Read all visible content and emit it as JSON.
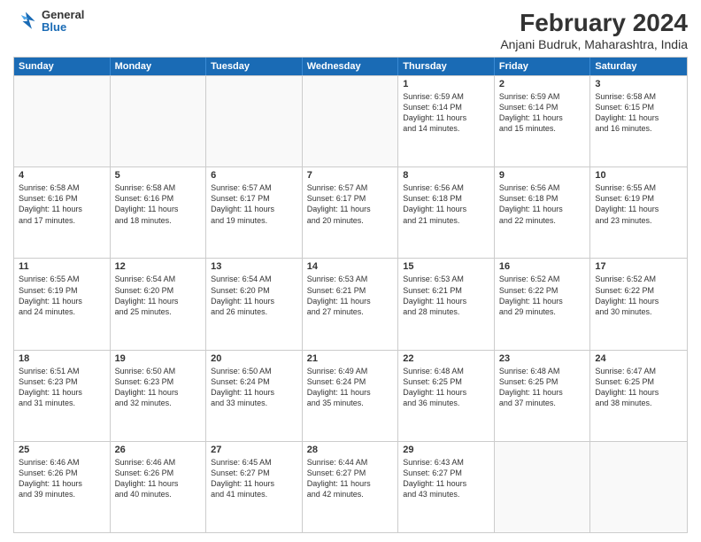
{
  "header": {
    "logo": {
      "general": "General",
      "blue": "Blue"
    },
    "month": "February 2024",
    "location": "Anjani Budruk, Maharashtra, India"
  },
  "weekdays": [
    "Sunday",
    "Monday",
    "Tuesday",
    "Wednesday",
    "Thursday",
    "Friday",
    "Saturday"
  ],
  "rows": [
    [
      {
        "day": "",
        "empty": true
      },
      {
        "day": "",
        "empty": true
      },
      {
        "day": "",
        "empty": true
      },
      {
        "day": "",
        "empty": true
      },
      {
        "day": "1",
        "info": "Sunrise: 6:59 AM\nSunset: 6:14 PM\nDaylight: 11 hours\nand 14 minutes."
      },
      {
        "day": "2",
        "info": "Sunrise: 6:59 AM\nSunset: 6:14 PM\nDaylight: 11 hours\nand 15 minutes."
      },
      {
        "day": "3",
        "info": "Sunrise: 6:58 AM\nSunset: 6:15 PM\nDaylight: 11 hours\nand 16 minutes."
      }
    ],
    [
      {
        "day": "4",
        "info": "Sunrise: 6:58 AM\nSunset: 6:16 PM\nDaylight: 11 hours\nand 17 minutes."
      },
      {
        "day": "5",
        "info": "Sunrise: 6:58 AM\nSunset: 6:16 PM\nDaylight: 11 hours\nand 18 minutes."
      },
      {
        "day": "6",
        "info": "Sunrise: 6:57 AM\nSunset: 6:17 PM\nDaylight: 11 hours\nand 19 minutes."
      },
      {
        "day": "7",
        "info": "Sunrise: 6:57 AM\nSunset: 6:17 PM\nDaylight: 11 hours\nand 20 minutes."
      },
      {
        "day": "8",
        "info": "Sunrise: 6:56 AM\nSunset: 6:18 PM\nDaylight: 11 hours\nand 21 minutes."
      },
      {
        "day": "9",
        "info": "Sunrise: 6:56 AM\nSunset: 6:18 PM\nDaylight: 11 hours\nand 22 minutes."
      },
      {
        "day": "10",
        "info": "Sunrise: 6:55 AM\nSunset: 6:19 PM\nDaylight: 11 hours\nand 23 minutes."
      }
    ],
    [
      {
        "day": "11",
        "info": "Sunrise: 6:55 AM\nSunset: 6:19 PM\nDaylight: 11 hours\nand 24 minutes."
      },
      {
        "day": "12",
        "info": "Sunrise: 6:54 AM\nSunset: 6:20 PM\nDaylight: 11 hours\nand 25 minutes."
      },
      {
        "day": "13",
        "info": "Sunrise: 6:54 AM\nSunset: 6:20 PM\nDaylight: 11 hours\nand 26 minutes."
      },
      {
        "day": "14",
        "info": "Sunrise: 6:53 AM\nSunset: 6:21 PM\nDaylight: 11 hours\nand 27 minutes."
      },
      {
        "day": "15",
        "info": "Sunrise: 6:53 AM\nSunset: 6:21 PM\nDaylight: 11 hours\nand 28 minutes."
      },
      {
        "day": "16",
        "info": "Sunrise: 6:52 AM\nSunset: 6:22 PM\nDaylight: 11 hours\nand 29 minutes."
      },
      {
        "day": "17",
        "info": "Sunrise: 6:52 AM\nSunset: 6:22 PM\nDaylight: 11 hours\nand 30 minutes."
      }
    ],
    [
      {
        "day": "18",
        "info": "Sunrise: 6:51 AM\nSunset: 6:23 PM\nDaylight: 11 hours\nand 31 minutes."
      },
      {
        "day": "19",
        "info": "Sunrise: 6:50 AM\nSunset: 6:23 PM\nDaylight: 11 hours\nand 32 minutes."
      },
      {
        "day": "20",
        "info": "Sunrise: 6:50 AM\nSunset: 6:24 PM\nDaylight: 11 hours\nand 33 minutes."
      },
      {
        "day": "21",
        "info": "Sunrise: 6:49 AM\nSunset: 6:24 PM\nDaylight: 11 hours\nand 35 minutes."
      },
      {
        "day": "22",
        "info": "Sunrise: 6:48 AM\nSunset: 6:25 PM\nDaylight: 11 hours\nand 36 minutes."
      },
      {
        "day": "23",
        "info": "Sunrise: 6:48 AM\nSunset: 6:25 PM\nDaylight: 11 hours\nand 37 minutes."
      },
      {
        "day": "24",
        "info": "Sunrise: 6:47 AM\nSunset: 6:25 PM\nDaylight: 11 hours\nand 38 minutes."
      }
    ],
    [
      {
        "day": "25",
        "info": "Sunrise: 6:46 AM\nSunset: 6:26 PM\nDaylight: 11 hours\nand 39 minutes."
      },
      {
        "day": "26",
        "info": "Sunrise: 6:46 AM\nSunset: 6:26 PM\nDaylight: 11 hours\nand 40 minutes."
      },
      {
        "day": "27",
        "info": "Sunrise: 6:45 AM\nSunset: 6:27 PM\nDaylight: 11 hours\nand 41 minutes."
      },
      {
        "day": "28",
        "info": "Sunrise: 6:44 AM\nSunset: 6:27 PM\nDaylight: 11 hours\nand 42 minutes."
      },
      {
        "day": "29",
        "info": "Sunrise: 6:43 AM\nSunset: 6:27 PM\nDaylight: 11 hours\nand 43 minutes."
      },
      {
        "day": "",
        "empty": true
      },
      {
        "day": "",
        "empty": true
      }
    ]
  ]
}
